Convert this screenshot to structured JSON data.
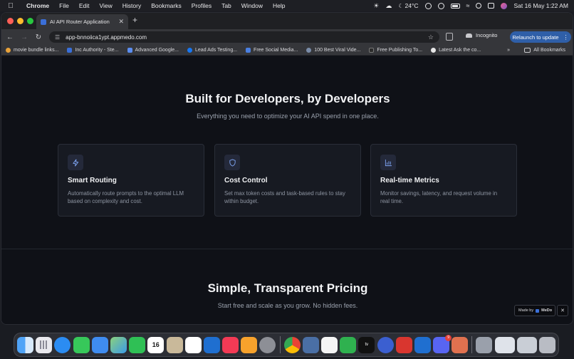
{
  "menubar": {
    "app_name": "Chrome",
    "menus": [
      "File",
      "Edit",
      "View",
      "History",
      "Bookmarks",
      "Profiles",
      "Tab",
      "Window",
      "Help"
    ],
    "temperature": "24°C",
    "datetime": "Sat 16 May  1:22 AM"
  },
  "browser": {
    "tab_title": "AI API Router Application",
    "url": "app-bnnoiica1ypt.appmedo.com",
    "incognito_label": "Incognito",
    "relaunch_label": "Relaunch to update",
    "bookmarks": [
      {
        "label": "movie bundle links...",
        "color": "#e8a23a"
      },
      {
        "label": "Inc Authority - Ste...",
        "color": "#3a6fd8"
      },
      {
        "label": "Advanced Google...",
        "color": "#5b8def"
      },
      {
        "label": "Lead Ads Testing...",
        "color": "#1877f2"
      },
      {
        "label": "Free Social Media...",
        "color": "#4a7fe0"
      },
      {
        "label": "100 Best Viral Vide...",
        "color": "#7a8ca8"
      },
      {
        "label": "Free Publishing To...",
        "color": "#2b2b2b"
      },
      {
        "label": "Latest Ask the co...",
        "color": "#e6e6e6"
      }
    ],
    "all_bookmarks_label": "All Bookmarks"
  },
  "hero": {
    "title": "Built for Developers, by Developers",
    "subtitle": "Everything you need to optimize your AI API spend in one place."
  },
  "features": [
    {
      "icon": "lightning-icon",
      "title": "Smart Routing",
      "desc": "Automatically route prompts to the optimal LLM based on complexity and cost."
    },
    {
      "icon": "shield-icon",
      "title": "Cost Control",
      "desc": "Set max token costs and task-based rules to stay within budget."
    },
    {
      "icon": "bar-chart-icon",
      "title": "Real-time Metrics",
      "desc": "Monitor savings, latency, and request volume in real time."
    }
  ],
  "pricing": {
    "title": "Simple, Transparent Pricing",
    "subtitle": "Start free and scale as you grow. No hidden fees."
  },
  "made_by": {
    "label": "Made by",
    "brand": "MeDo"
  },
  "dock": {
    "calendar_day": "16",
    "discord_badge": "9"
  },
  "colors": {
    "accent": "#3b6fd8",
    "page_bg": "#0f1117",
    "card_bg": "#171a22",
    "relaunch_bg": "#2f5fa8"
  }
}
